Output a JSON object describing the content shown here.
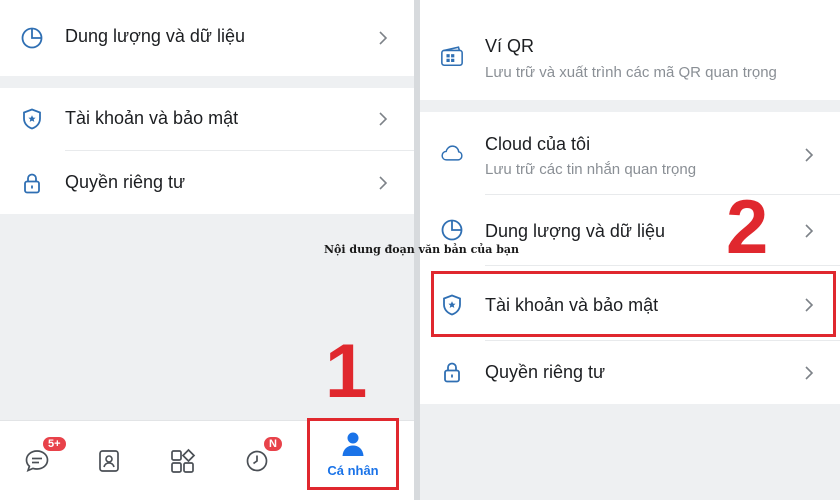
{
  "left": {
    "items": [
      {
        "label": "Dung lượng và dữ liệu",
        "icon": "storage-pie-icon"
      },
      {
        "label": "Tài khoản và bảo mật",
        "icon": "shield-star-icon"
      },
      {
        "label": "Quyền riêng tư",
        "icon": "lock-icon"
      }
    ],
    "tabbar": {
      "tabs": [
        {
          "name": "messages",
          "icon": "chat-icon",
          "badge": "5+"
        },
        {
          "name": "contacts",
          "icon": "contacts-icon"
        },
        {
          "name": "discover",
          "icon": "grid-icon"
        },
        {
          "name": "timeline",
          "icon": "clock-icon",
          "badge": "N"
        },
        {
          "name": "personal",
          "icon": "person-icon",
          "label": "Cá nhân",
          "active": true
        }
      ]
    },
    "step_number": "1"
  },
  "right": {
    "qr": {
      "title": "Ví QR",
      "subtitle": "Lưu trữ và xuất trình các mã QR quan trọng",
      "icon": "qr-wallet-icon"
    },
    "cloud": {
      "title": "Cloud của tôi",
      "subtitle": "Lưu trữ các tin nhắn quan trọng",
      "icon": "cloud-icon"
    },
    "storage": {
      "title": "Dung lượng và dữ liệu",
      "icon": "storage-pie-icon"
    },
    "account": {
      "title": "Tài khoản và bảo mật",
      "icon": "shield-star-icon"
    },
    "privacy": {
      "title": "Quyền riêng tư",
      "icon": "lock-icon"
    },
    "step_number": "2"
  },
  "overlay_text": "Nội dung đoạn văn bản của bạn",
  "colors": {
    "accent": "#1a73e8",
    "highlight": "#e0282e",
    "badge": "#e8424a",
    "icon": "#2f6fb3"
  }
}
